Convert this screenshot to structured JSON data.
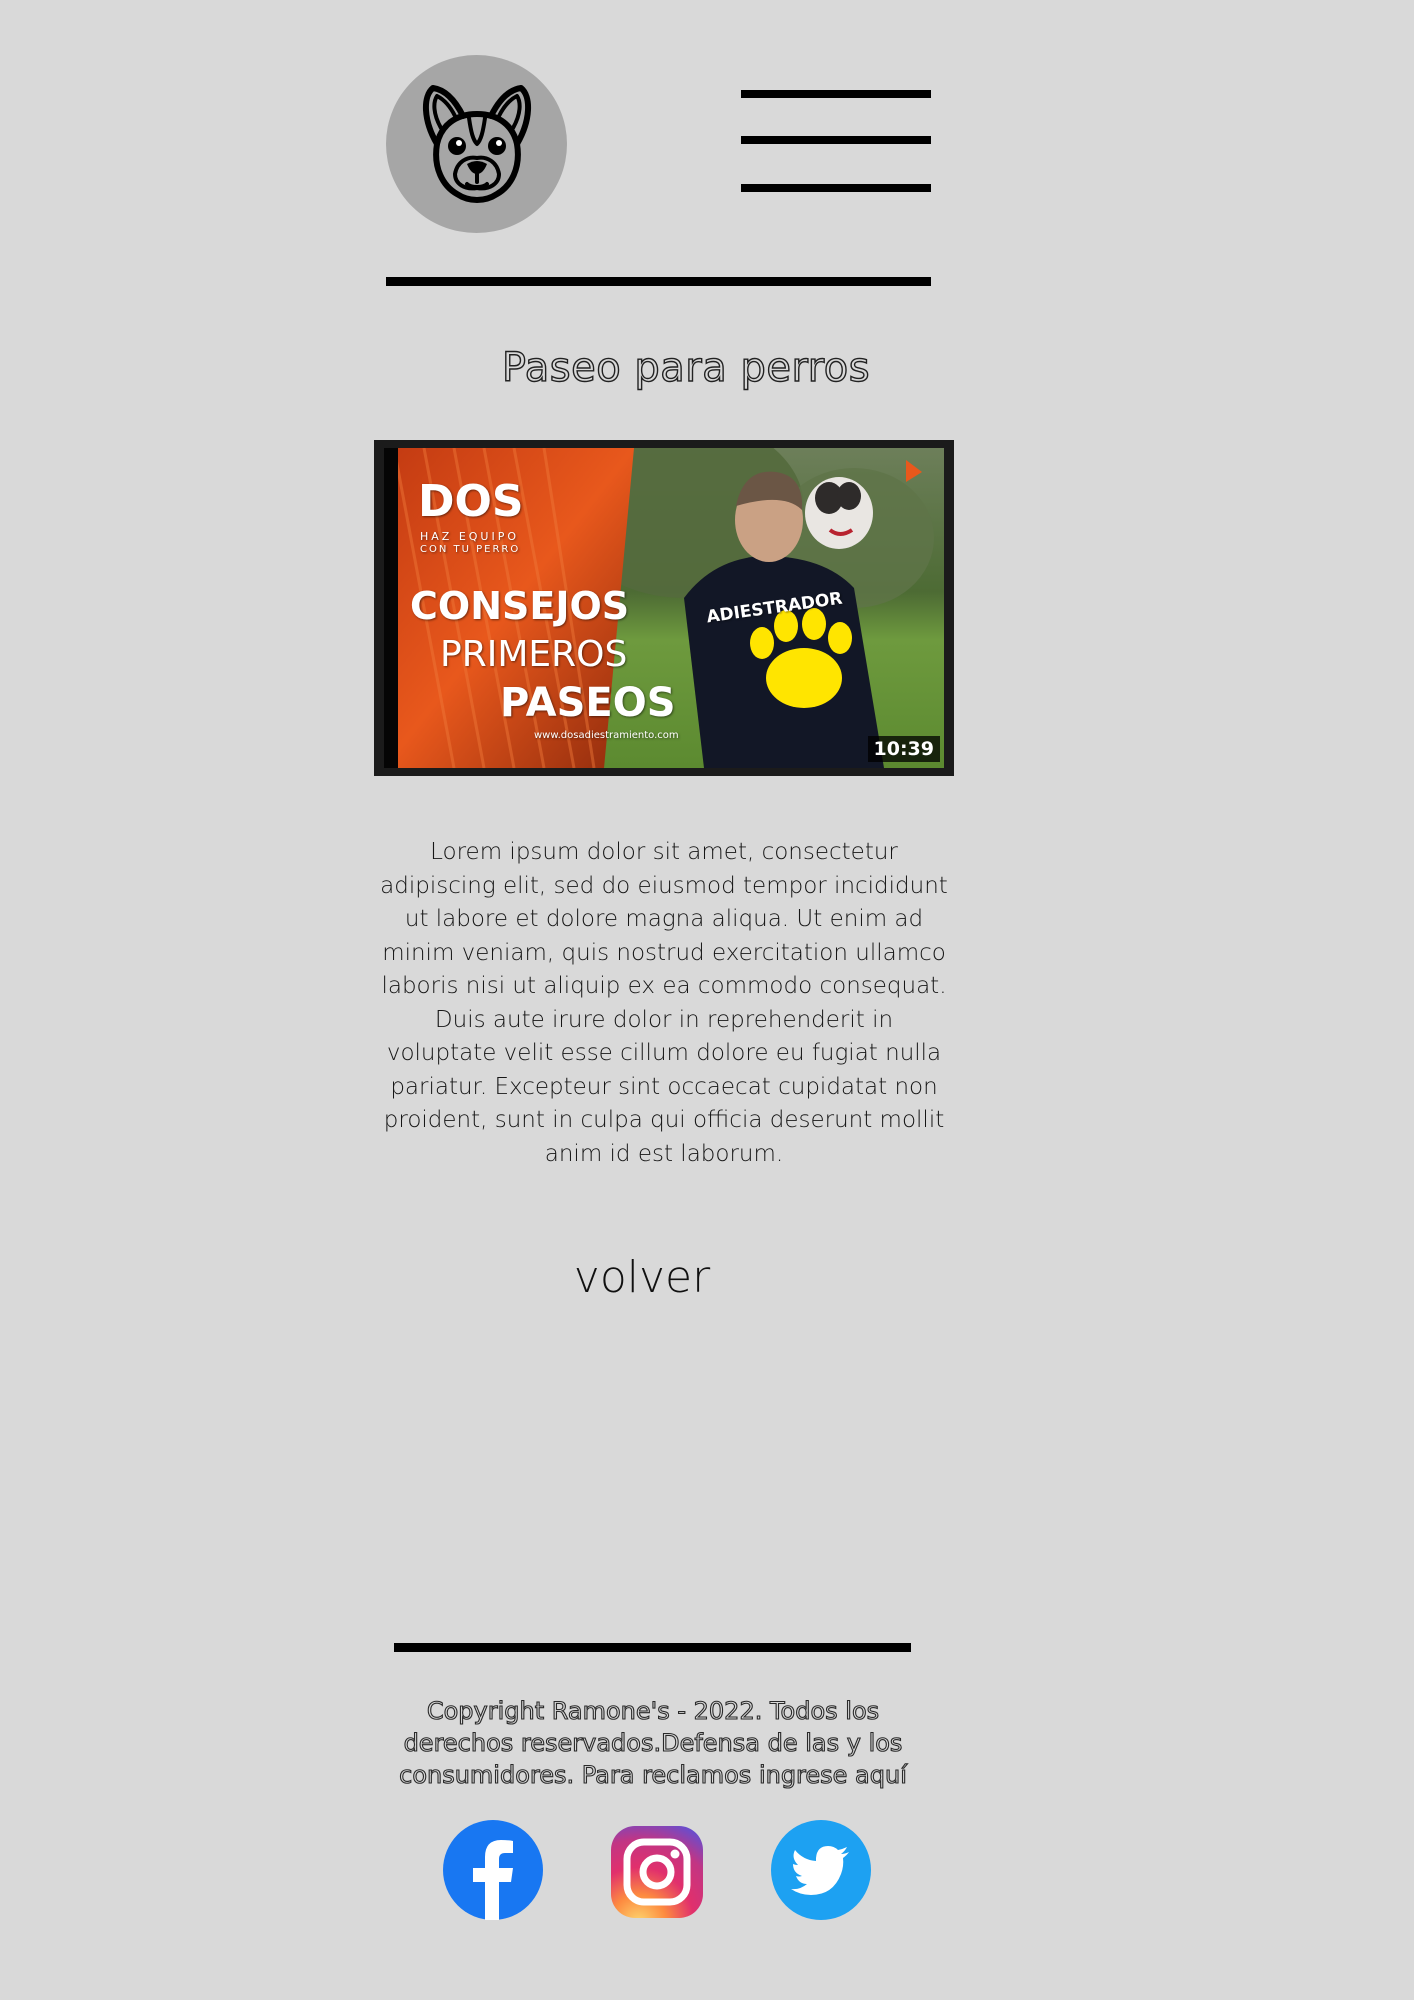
{
  "header": {
    "logo_icon": "french-bulldog-icon",
    "menu_icon": "hamburger-menu-icon"
  },
  "page_title": "Paseo para perros",
  "video": {
    "brand": "DOS",
    "tagline_1": "HAZ EQUIPO",
    "tagline_2": "CON TU PERRO",
    "headline_1": "CONSEJOS",
    "headline_2": "PRIMEROS",
    "headline_3": "PASEOS",
    "website": "www.dosadiestramiento.com",
    "shirt_text": "ADIESTRADOR",
    "duration": "10:39"
  },
  "body_text": "Lorem ipsum dolor sit amet, consectetur adipiscing elit, sed do eiusmod tempor incididunt ut labore et dolore magna aliqua. Ut enim ad minim veniam, quis nostrud exercitation ullamco laboris nisi ut aliquip ex ea commodo consequat. Duis aute irure dolor in reprehenderit in voluptate velit esse cillum dolore eu fugiat nulla pariatur. Excepteur sint occaecat cupidatat non proident, sunt in culpa qui officia deserunt mollit anim id est laborum.",
  "back_label": "volver",
  "footer": {
    "copyright": "Copyright Ramone's - 2022. Todos los derechos reservados.Defensa de las y los consumidores. Para reclamos ingrese aquí"
  },
  "social": [
    {
      "icon": "facebook-icon",
      "color": "#1877f2"
    },
    {
      "icon": "instagram-icon",
      "color": "#d6249f"
    },
    {
      "icon": "twitter-icon",
      "color": "#1da1f2"
    }
  ],
  "colors": {
    "background": "#d9d9d9",
    "logo_circle": "#a6a6a6",
    "rule": "#000000"
  }
}
